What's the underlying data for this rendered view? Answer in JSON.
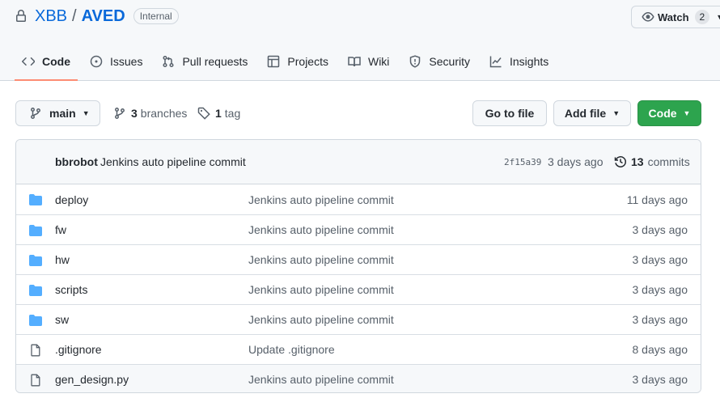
{
  "repo": {
    "owner": "XBB",
    "name": "AVED",
    "visibility": "Internal",
    "watch_label": "Watch",
    "watch_count": "2"
  },
  "tabs": [
    {
      "label": "Code",
      "icon": "code-icon"
    },
    {
      "label": "Issues",
      "icon": "issue-icon"
    },
    {
      "label": "Pull requests",
      "icon": "pull-request-icon"
    },
    {
      "label": "Projects",
      "icon": "table-icon"
    },
    {
      "label": "Wiki",
      "icon": "book-icon"
    },
    {
      "label": "Security",
      "icon": "shield-icon"
    },
    {
      "label": "Insights",
      "icon": "graph-icon"
    }
  ],
  "branch_bar": {
    "current_branch": "main",
    "branches_count": "3",
    "branches_label": "branches",
    "tags_count": "1",
    "tags_label": "tag",
    "go_to_file": "Go to file",
    "add_file": "Add file",
    "code": "Code"
  },
  "latest_commit": {
    "author": "bbrobot",
    "message": "Jenkins auto pipeline commit",
    "sha": "2f15a39",
    "ago": "3 days ago",
    "commits_count": "13",
    "commits_label": "commits"
  },
  "files": [
    {
      "name": "deploy",
      "type": "dir",
      "message": "Jenkins auto pipeline commit",
      "age": "11 days ago"
    },
    {
      "name": "fw",
      "type": "dir",
      "message": "Jenkins auto pipeline commit",
      "age": "3 days ago"
    },
    {
      "name": "hw",
      "type": "dir",
      "message": "Jenkins auto pipeline commit",
      "age": "3 days ago"
    },
    {
      "name": "scripts",
      "type": "dir",
      "message": "Jenkins auto pipeline commit",
      "age": "3 days ago"
    },
    {
      "name": "sw",
      "type": "dir",
      "message": "Jenkins auto pipeline commit",
      "age": "3 days ago"
    },
    {
      "name": ".gitignore",
      "type": "file",
      "message": "Update .gitignore",
      "age": "8 days ago"
    },
    {
      "name": "gen_design.py",
      "type": "file",
      "message": "Jenkins auto pipeline commit",
      "age": "3 days ago"
    }
  ],
  "colors": {
    "link": "#0969da",
    "folder": "#54aeff",
    "primary_button": "#2da44e",
    "active_tab_underline": "#fd8c73"
  }
}
